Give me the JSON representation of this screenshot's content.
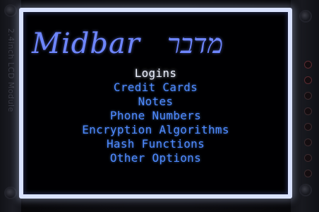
{
  "device": {
    "module_label": "2.4inch LCD Module"
  },
  "app": {
    "logo_latin": "Midbar",
    "logo_hebrew": "מדבר"
  },
  "menu": {
    "selected_index": 0,
    "items": [
      {
        "label": "Logins"
      },
      {
        "label": "Credit Cards"
      },
      {
        "label": "Notes"
      },
      {
        "label": "Phone Numbers"
      },
      {
        "label": "Encryption Algorithms"
      },
      {
        "label": "Hash Functions"
      },
      {
        "label": "Other Options"
      }
    ]
  },
  "colors": {
    "logo": "#6e86ff",
    "menu_item": "#4f8bff",
    "menu_item_selected": "#eef2ff",
    "screen_background": "#000002"
  }
}
